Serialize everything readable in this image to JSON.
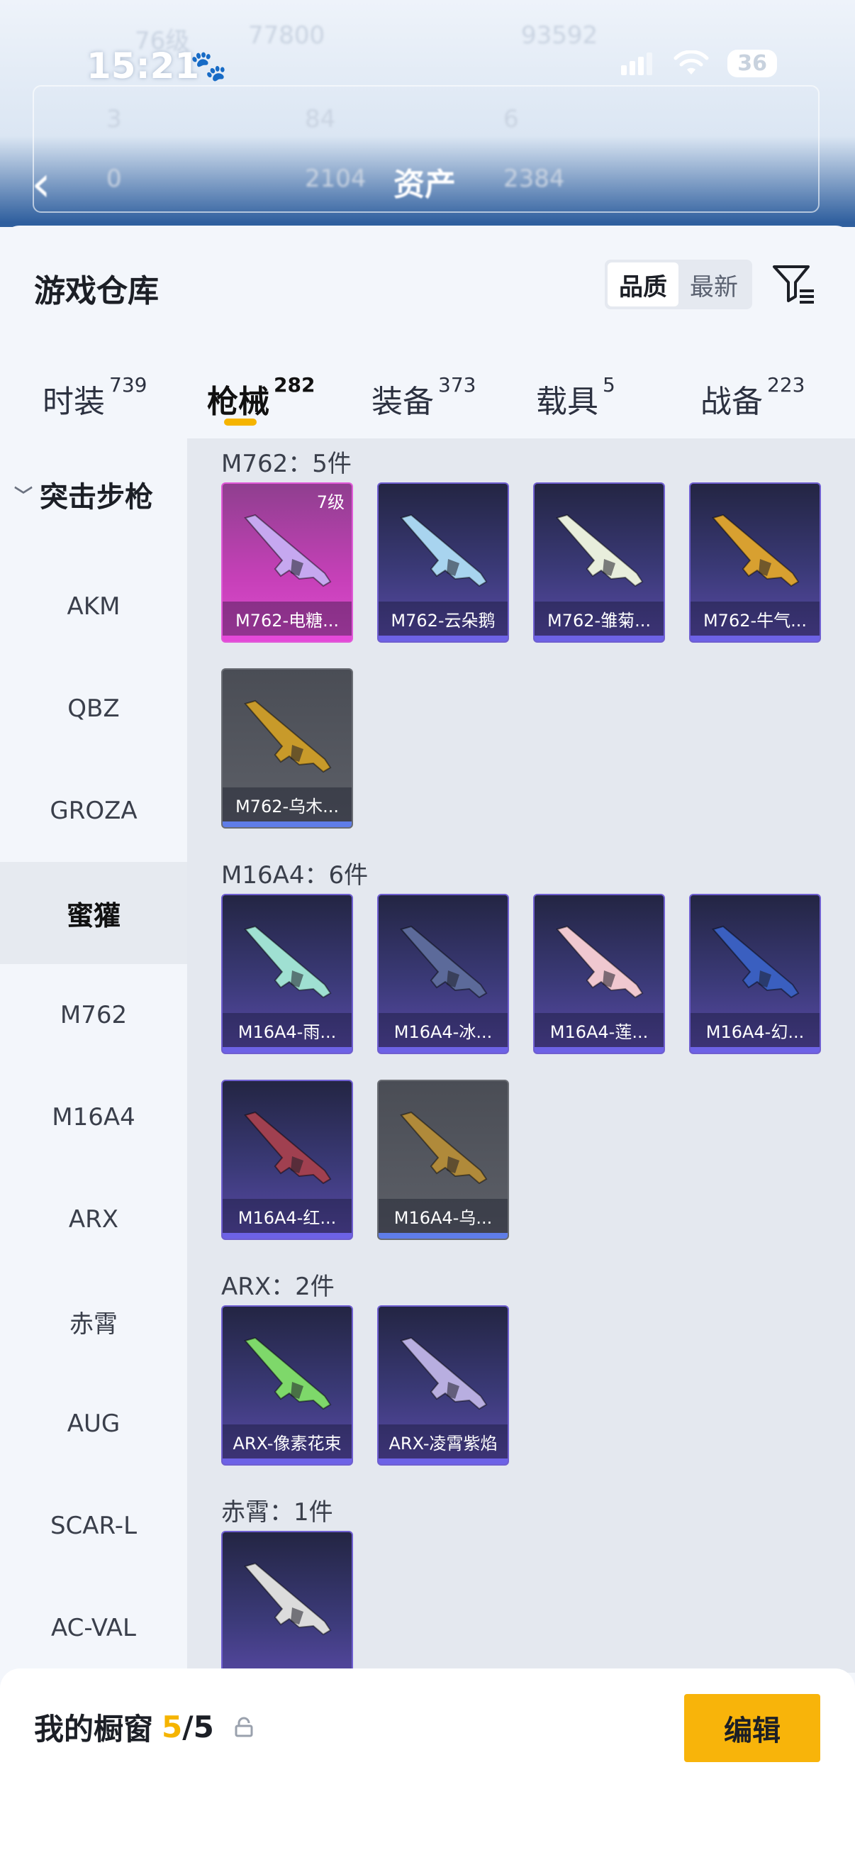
{
  "status_bar": {
    "time": "15:21",
    "battery": "36"
  },
  "header_bg": {
    "back_title": "资产",
    "ghost_values": [
      "76级",
      "77800",
      "93592",
      "3",
      "84",
      "6",
      "0",
      "2104",
      "2384"
    ]
  },
  "sheet": {
    "title": "游戏仓库",
    "sort_options": [
      "品质",
      "最新"
    ],
    "sort_selected": "品质",
    "tabs": [
      {
        "label": "时装",
        "count": "739"
      },
      {
        "label": "枪械",
        "count": "282"
      },
      {
        "label": "装备",
        "count": "373"
      },
      {
        "label": "载具",
        "count": "5"
      },
      {
        "label": "战备",
        "count": "223"
      }
    ],
    "active_tab": "枪械"
  },
  "left_nav": {
    "header": "突击步枪",
    "items": [
      "AKM",
      "QBZ",
      "GROZA",
      "蜜獾",
      "M762",
      "M16A4",
      "ARX",
      "赤霄",
      "AUG",
      "SCAR-L",
      "AC-VAL"
    ],
    "selected": "蜜獾"
  },
  "groups": [
    {
      "title": "M762：5件",
      "items": [
        {
          "name": "M762-电糖...",
          "level": "7级",
          "rarity": "pink"
        },
        {
          "name": "M762-云朵鹅",
          "rarity": "purple"
        },
        {
          "name": "M762-雏菊...",
          "rarity": "purple"
        },
        {
          "name": "M762-牛气...",
          "rarity": "purple"
        },
        {
          "name": "M762-乌木...",
          "rarity": "grey"
        }
      ]
    },
    {
      "title": "M16A4：6件",
      "items": [
        {
          "name": "M16A4-雨...",
          "rarity": "purple"
        },
        {
          "name": "M16A4-冰...",
          "rarity": "purple"
        },
        {
          "name": "M16A4-莲...",
          "rarity": "purple"
        },
        {
          "name": "M16A4-幻...",
          "rarity": "purple"
        },
        {
          "name": "M16A4-红...",
          "rarity": "purple"
        },
        {
          "name": "M16A4-乌...",
          "rarity": "grey"
        }
      ]
    },
    {
      "title": "ARX：2件",
      "items": [
        {
          "name": "ARX-像素花束",
          "rarity": "purple"
        },
        {
          "name": "ARX-凌霄紫焰",
          "rarity": "purple"
        }
      ]
    },
    {
      "title": "赤霄：1件",
      "items": [
        {
          "name": "",
          "rarity": "purple"
        }
      ]
    }
  ],
  "bottom": {
    "label": "我的橱窗",
    "count": "5",
    "total": "/5",
    "edit_label": "编辑"
  },
  "colors": {
    "accent": "#f5b400",
    "pink_rarity": "#de4bd0",
    "purple_rarity": "#5a4aa8",
    "grey_rarity": "#5d6068"
  },
  "icons": {
    "filter": "filter-list-icon",
    "share": "share-external-icon",
    "lock": "lock-icon",
    "back": "back-arrow-icon"
  }
}
